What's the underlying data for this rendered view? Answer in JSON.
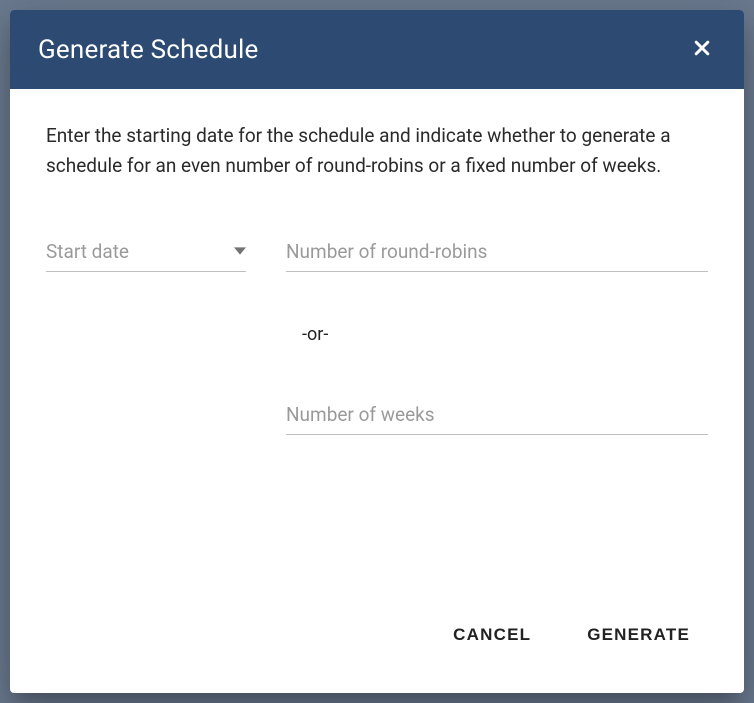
{
  "modal": {
    "title": "Generate Schedule",
    "description": "Enter the starting date for the schedule and indicate whether to generate a schedule for an even number of round-robins or a fixed number of weeks.",
    "fields": {
      "start_date": {
        "placeholder": "Start date",
        "value": ""
      },
      "round_robins": {
        "placeholder": "Number of round-robins",
        "value": ""
      },
      "separator": "-or-",
      "weeks": {
        "placeholder": "Number of weeks",
        "value": ""
      }
    },
    "actions": {
      "cancel": "CANCEL",
      "generate": "GENERATE"
    }
  }
}
